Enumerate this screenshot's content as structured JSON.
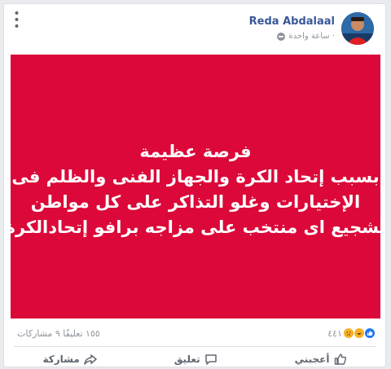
{
  "post": {
    "author": "Reda Abdalaal",
    "time": "ساعة واحدة ·",
    "banner_lines": [
      "فرصة عظيمة",
      "بسبب إتحاد الكرة والجهاز الفنى والظلم فى",
      "الإختيارات وغلو التذاكر على كل مواطن",
      "تشجيع اى منتخب على مزاجه برافو إتحادالكرة"
    ],
    "banner_color": "#db0839"
  },
  "stats": {
    "reactions_count": "٤٤١",
    "comments_shares": "١٥٥ تعليقًا  ٩ مشاركات"
  },
  "actions": {
    "like": "أعجبني",
    "comment": "تعليق",
    "share": "مشاركة"
  },
  "icons": {
    "options": "more-options-icon",
    "privacy": "globe-icon",
    "like": "thumbs-up-icon",
    "comment": "comment-bubble-icon",
    "share": "share-arrow-icon"
  }
}
